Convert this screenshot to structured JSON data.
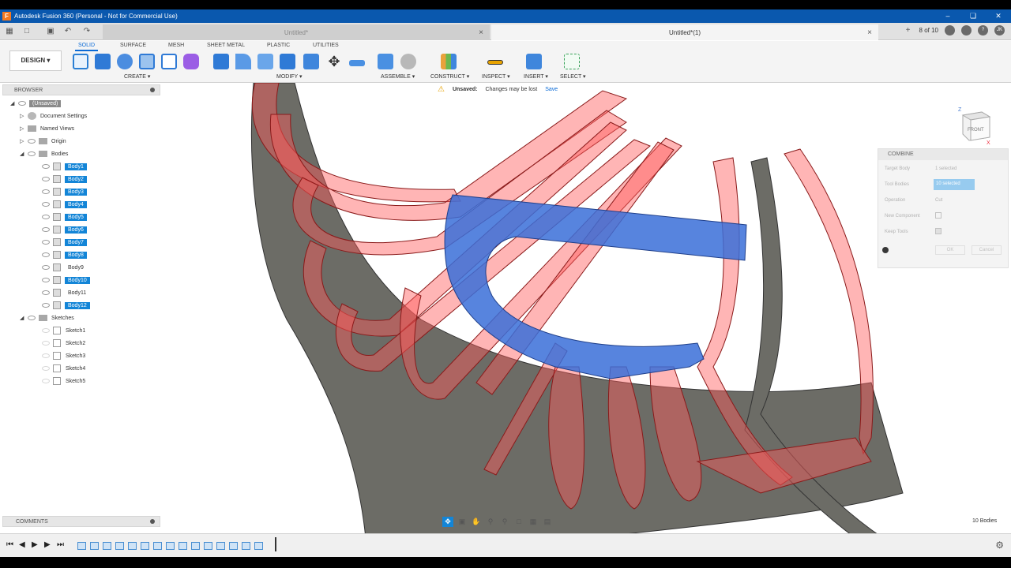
{
  "app": {
    "title": "Autodesk Fusion 360 (Personal - Not for Commercial Use)",
    "logo_letter": "F"
  },
  "tabs": [
    {
      "label": "Untitled*",
      "active": false
    },
    {
      "label": "Untitled*(1)",
      "active": true
    }
  ],
  "tabbar": {
    "page_count": "8 of 10",
    "user_initials": "JK"
  },
  "ribbon": {
    "workspace": "DESIGN",
    "tabs": [
      "SOLID",
      "SURFACE",
      "MESH",
      "SHEET METAL",
      "PLASTIC",
      "UTILITIES"
    ],
    "active_tab": "SOLID",
    "groups": [
      "CREATE",
      "MODIFY",
      "ASSEMBLE",
      "CONSTRUCT",
      "INSPECT",
      "INSERT",
      "SELECT"
    ]
  },
  "notice": {
    "label": "Unsaved:",
    "message": "Changes may be lost",
    "action": "Save"
  },
  "browser": {
    "title": "BROWSER",
    "root": "(Unsaved)",
    "items": [
      {
        "label": "Document Settings"
      },
      {
        "label": "Named Views"
      },
      {
        "label": "Origin"
      },
      {
        "label": "Bodies"
      }
    ],
    "bodies": [
      {
        "label": "Body1",
        "selected": true
      },
      {
        "label": "Body2",
        "selected": true
      },
      {
        "label": "Body3",
        "selected": true
      },
      {
        "label": "Body4",
        "selected": true
      },
      {
        "label": "Body5",
        "selected": true
      },
      {
        "label": "Body6",
        "selected": true
      },
      {
        "label": "Body7",
        "selected": true
      },
      {
        "label": "Body8",
        "selected": true
      },
      {
        "label": "Body9",
        "selected": false
      },
      {
        "label": "Body10",
        "selected": true
      },
      {
        "label": "Body11",
        "selected": false
      },
      {
        "label": "Body12",
        "selected": true
      }
    ],
    "sketches_label": "Sketches",
    "sketches": [
      "Sketch1",
      "Sketch2",
      "Sketch3",
      "Sketch4",
      "Sketch5"
    ]
  },
  "viewcube": {
    "face": "FRONT",
    "axis_z": "Z",
    "axis_x": "X"
  },
  "combine": {
    "title": "COMBINE",
    "rows": [
      {
        "label": "Target Body",
        "value": "1 selected"
      },
      {
        "label": "Tool Bodies",
        "value": "10 selected"
      },
      {
        "label": "Operation",
        "value": "Cut"
      },
      {
        "label": "New Component",
        "value": ""
      },
      {
        "label": "Keep Tools",
        "value": ""
      }
    ],
    "ok": "OK",
    "cancel": "Cancel"
  },
  "comments": {
    "title": "COMMENTS"
  },
  "status": {
    "body_count": "10 Bodies"
  },
  "colors": {
    "accent": "#1385d7",
    "titlebar": "#0a58ae",
    "tool_body": "#ff5a5a",
    "target_body": "#3a6fd8",
    "gray_body": "#6c6c66"
  }
}
